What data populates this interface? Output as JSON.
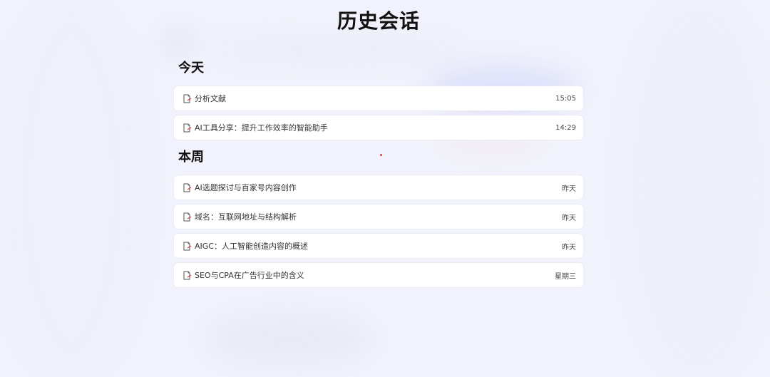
{
  "page": {
    "title": "历史会话"
  },
  "sections": {
    "today": {
      "title": "今天",
      "items": [
        {
          "title": "分析文献",
          "time": "15:05",
          "icon": "document-edit-icon"
        },
        {
          "title": "AI工具分享：提升工作效率的智能助手",
          "time": "14:29",
          "icon": "document-edit-icon"
        }
      ]
    },
    "week": {
      "title": "本周",
      "items": [
        {
          "title": "AI选题探讨与百家号内容创作",
          "time": "昨天",
          "icon": "document-edit-icon"
        },
        {
          "title": "域名：互联网地址与结构解析",
          "time": "昨天",
          "icon": "document-edit-icon"
        },
        {
          "title": "AIGC：人工智能创造内容的概述",
          "time": "昨天",
          "icon": "document-edit-icon"
        },
        {
          "title": "SEO与CPA在广告行业中的含义",
          "time": "星期三",
          "icon": "document-edit-icon"
        }
      ]
    }
  },
  "colors": {
    "background": "#f1f2fb",
    "card": "#ffffff",
    "icon_accent": "#e53935",
    "text": "#333333"
  }
}
